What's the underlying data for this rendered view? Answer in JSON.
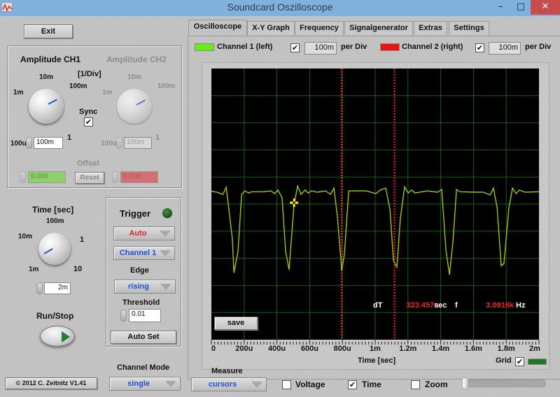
{
  "window": {
    "title": "Soundcard Oszilloscope",
    "minimize": "–",
    "maximize": "□",
    "close": "✕",
    "app_icon": "oscilloscope-app-icon"
  },
  "left": {
    "exit_label": "Exit",
    "amplitude": {
      "ch1_title": "Amplitude CH1",
      "ch2_title": "Amplitude CH2",
      "unit_label": "[1/Div]",
      "knob_scale": [
        "100u",
        "1m",
        "10m",
        "100m",
        "1"
      ],
      "ch1_value": "100m",
      "ch2_value": "100m",
      "sync_label": "Sync",
      "sync_checked": true,
      "offset_label": "Offset",
      "offset_ch1": "0.000",
      "offset_ch2": "0.000",
      "reset_label": "Reset"
    },
    "time": {
      "title": "Time [sec]",
      "knob_scale": [
        "1m",
        "10m",
        "100m",
        "1",
        "10"
      ],
      "value": "2m"
    },
    "run_stop_label": "Run/Stop",
    "trigger": {
      "title": "Trigger",
      "mode": "Auto",
      "channel": "Channel 1",
      "edge_label": "Edge",
      "edge": "rising",
      "threshold_label": "Threshold",
      "threshold": "0.01",
      "autoset_label": "Auto Set",
      "led_color": "#1f5a1f"
    },
    "channel_mode_label": "Channel Mode",
    "channel_mode": "single",
    "copyright": "© 2012  C. Zeitnitz V1.41"
  },
  "tabs": [
    {
      "label": "Oscilloscope",
      "active": true
    },
    {
      "label": "X-Y Graph",
      "active": false
    },
    {
      "label": "Frequency",
      "active": false
    },
    {
      "label": "Signalgenerator",
      "active": false
    },
    {
      "label": "Extras",
      "active": false
    },
    {
      "label": "Settings",
      "active": false
    }
  ],
  "scope": {
    "ch1": {
      "label": "Channel 1 (left)",
      "color": "#66ee11",
      "enabled": true,
      "per_div": "100m",
      "per_div_label": "per Div"
    },
    "ch2": {
      "label": "Channel 2 (right)",
      "color": "#ee1111",
      "enabled": true,
      "per_div": "100m",
      "per_div_label": "per Div"
    },
    "save_label": "save",
    "measure_dT_label": "dT",
    "measure_dT_value": "323.457u",
    "measure_dT_unit": "sec",
    "measure_f_label": "f",
    "measure_f_value": "3.0916k",
    "measure_f_unit": "Hz",
    "grid_label": "Grid",
    "grid_checked": true,
    "grid_color": "#1c7a1c",
    "measure_label": "Measure",
    "measure_mode": "cursors",
    "voltage_label": "Voltage",
    "voltage_checked": false,
    "time_label": "Time",
    "time_checked": true,
    "zoom_label": "Zoom",
    "zoom_checked": false,
    "zoom_slider_value": 0
  },
  "chart_data": {
    "type": "line",
    "title": "",
    "xlabel": "Time [sec]",
    "ylabel": "",
    "xlim": [
      0,
      0.002
    ],
    "ylim": [
      -0.5,
      0.5
    ],
    "grid": true,
    "x_ticks": [
      "0",
      "200u",
      "400u",
      "600u",
      "800u",
      "1m",
      "1.2m",
      "1.4m",
      "1.6m",
      "1.8m",
      "2m"
    ],
    "x_tick_values": [
      0,
      0.0002,
      0.0004,
      0.0006,
      0.0008,
      0.001,
      0.0012,
      0.0014,
      0.0016,
      0.0018,
      0.002
    ],
    "y_divisions": 10,
    "cursors_x": [
      0.000795,
      0.001118
    ],
    "crosshair": {
      "x": 0.000505,
      "y": 0.005
    },
    "series": [
      {
        "name": "Channel 1 (left)",
        "color": "#7ae01a",
        "points": [
          [
            0,
            0.048
          ],
          [
            3.4e-05,
            0.044
          ],
          [
            7e-05,
            0.036
          ],
          [
            9e-05,
            0.062
          ],
          [
            0.000107,
            -0.021
          ],
          [
            0.000128,
            -0.131
          ],
          [
            0.000137,
            -0.253
          ],
          [
            0.000162,
            -0.175
          ],
          [
            0.000184,
            0.036
          ],
          [
            0.000205,
            0.049
          ],
          [
            0.000226,
            0.041
          ],
          [
            0.000248,
            0.046
          ],
          [
            0.00032,
            0.046
          ],
          [
            0.000363,
            0.049
          ],
          [
            0.000385,
            0.039
          ],
          [
            0.000406,
            0.052
          ],
          [
            0.000431,
            0.023
          ],
          [
            0.000453,
            -0.175
          ],
          [
            0.000474,
            -0.242
          ],
          [
            0.000504,
            -0.003
          ],
          [
            0.000526,
            0.067
          ],
          [
            0.000547,
            0.036
          ],
          [
            0.000572,
            0.052
          ],
          [
            0.00059,
            0.041
          ],
          [
            0.000612,
            0.049
          ],
          [
            0.000646,
            0.044
          ],
          [
            0.000697,
            0.049
          ],
          [
            0.000727,
            0.036
          ],
          [
            0.000748,
            0.059
          ],
          [
            0.000769,
            -0.046
          ],
          [
            0.000791,
            -0.209
          ],
          [
            0.000795,
            -0.245
          ],
          [
            0.000812,
            -0.183
          ],
          [
            0.000838,
            0.049
          ],
          [
            0.000945,
            0.049
          ],
          [
            0.001004,
            0.039
          ],
          [
            0.00103,
            0.052
          ],
          [
            0.001064,
            0.059
          ],
          [
            0.00109,
            -0.021
          ],
          [
            0.001111,
            -0.209
          ],
          [
            0.001132,
            -0.232
          ],
          [
            0.001153,
            -0.054
          ],
          [
            0.001179,
            0.064
          ],
          [
            0.001201,
            0.041
          ],
          [
            0.001222,
            0.052
          ],
          [
            0.001243,
            0.041
          ],
          [
            0.001316,
            0.049
          ],
          [
            0.00138,
            0.044
          ],
          [
            0.001406,
            0.054
          ],
          [
            0.001431,
            -0.168
          ],
          [
            0.001453,
            -0.26
          ],
          [
            0.001474,
            -0.142
          ],
          [
            0.001496,
            0.054
          ],
          [
            0.001517,
            0.046
          ],
          [
            0.001603,
            0.044
          ],
          [
            0.001658,
            0.044
          ],
          [
            0.001701,
            0.034
          ],
          [
            0.001722,
            0.059
          ],
          [
            0.001744,
            -0.013
          ],
          [
            0.001769,
            -0.227
          ],
          [
            0.001786,
            -0.219
          ],
          [
            0.001816,
            -0.013
          ],
          [
            0.001838,
            0.059
          ],
          [
            0.001859,
            0.039
          ],
          [
            0.00188,
            0.052
          ],
          [
            0.001915,
            0.044
          ],
          [
            0.002,
            0.046
          ]
        ]
      }
    ]
  }
}
